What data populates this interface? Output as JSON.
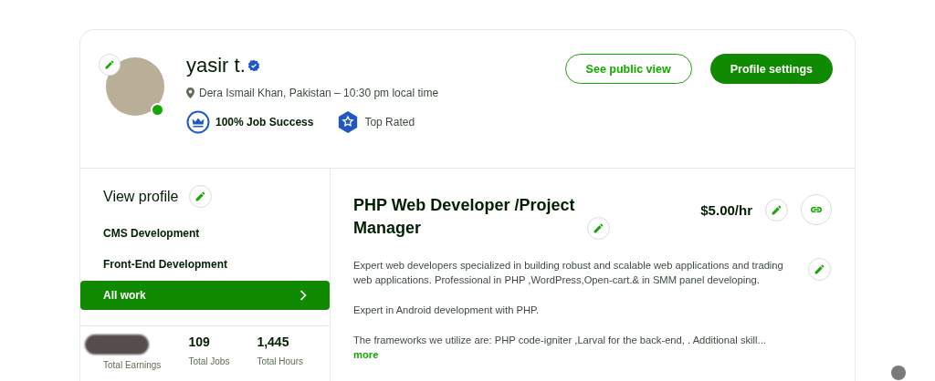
{
  "profile": {
    "name": "yasir t.",
    "verified": true,
    "online": true,
    "location": "Dera Ismail Khan, Pakistan – 10:30 pm local time",
    "badges": [
      {
        "kind": "job-success",
        "label": "100% Job Success"
      },
      {
        "kind": "top-rated",
        "label": "Top Rated"
      }
    ]
  },
  "actions": [
    {
      "kind": "outline",
      "label": "See public view"
    },
    {
      "kind": "filled",
      "label": "Profile settings"
    }
  ],
  "sidebar": {
    "title": "View profile",
    "items": [
      {
        "label": "CMS Development",
        "selected": false
      },
      {
        "label": "Front-End Development",
        "selected": false
      },
      {
        "label": "All work",
        "selected": true
      }
    ]
  },
  "stats": [
    {
      "label": "Total Earnings",
      "redacted": true
    },
    {
      "value": "109",
      "label": "Total Jobs",
      "redacted": false
    },
    {
      "value": "1,445",
      "label": "Total Hours",
      "redacted": false
    }
  ],
  "job": {
    "title": "PHP Web Developer /Project Manager",
    "rate": "$5.00/hr",
    "paragraphs": [
      "Expert web developers specialized in building robust and scalable web applications and trading web applications. Professional in PHP ,WordPress,Open-cart.& in SMM panel developing.",
      "Expert in Android development with PHP.",
      "The frameworks we utilize are: PHP code-igniter ,Larval for the back-end, . Additional skill..."
    ],
    "more": "more"
  }
}
